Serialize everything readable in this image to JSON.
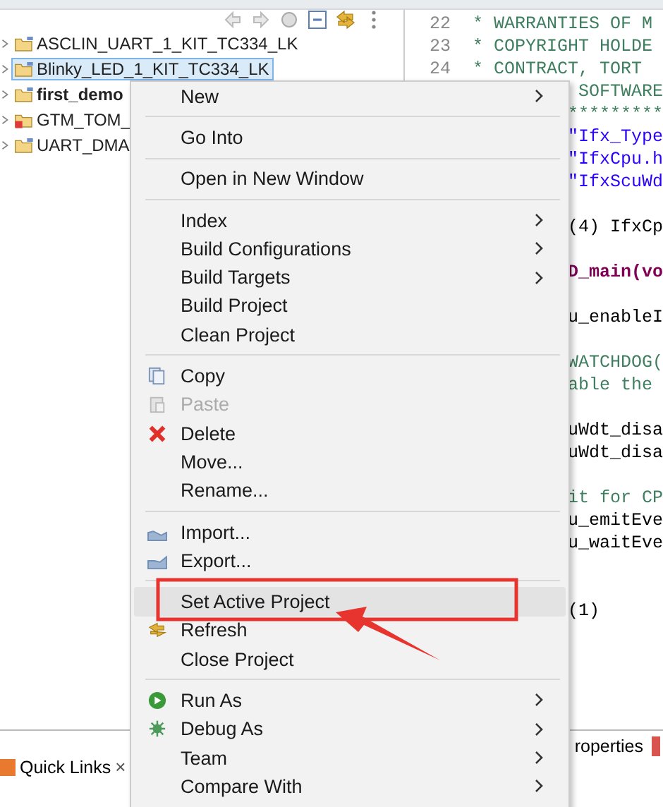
{
  "project_tree": {
    "items": [
      {
        "label": "ASCLIN_UART_1_KIT_TC334_LK",
        "selected": false,
        "bold": false,
        "has_error": false
      },
      {
        "label": "Blinky_LED_1_KIT_TC334_LK",
        "selected": true,
        "bold": false,
        "has_error": false
      },
      {
        "label": "first_demo",
        "selected": false,
        "bold": true,
        "has_error": false
      },
      {
        "label": "GTM_TOM_",
        "selected": false,
        "bold": false,
        "has_error": true
      },
      {
        "label": "UART_DMA",
        "selected": false,
        "bold": false,
        "has_error": false
      }
    ]
  },
  "editor": {
    "numbered_lines": [
      {
        "number": "22",
        "text": " * WARRANTIES OF M",
        "kind": "comment"
      },
      {
        "number": "23",
        "text": " * COPYRIGHT HOLDE",
        "kind": "comment"
      },
      {
        "number": "24",
        "text": " * CONTRACT, TORT",
        "kind": "comment"
      }
    ],
    "visible_fragments": [
      {
        "text": " SOFTWARE",
        "kind": "comment"
      },
      {
        "text": "*********",
        "kind": "comment"
      },
      {
        "text": "\"Ifx_Type",
        "kind": "string"
      },
      {
        "text": "\"IfxCpu.h",
        "kind": "string"
      },
      {
        "text": "\"IfxScuWd",
        "kind": "string"
      },
      {
        "kind": "blank"
      },
      {
        "text": "(4) IfxCp",
        "kind": "code"
      },
      {
        "kind": "blank"
      },
      {
        "text": "D_main(vo",
        "kind": "bold"
      },
      {
        "kind": "blank"
      },
      {
        "text": "u_enableI",
        "kind": "code"
      },
      {
        "kind": "blank"
      },
      {
        "text": "WATCHDOG(",
        "kind": "comment"
      },
      {
        "text": "able the",
        "kind": "comment"
      },
      {
        "kind": "blank"
      },
      {
        "text": "uWdt_disa",
        "kind": "code"
      },
      {
        "text": "uWdt_disa",
        "kind": "code"
      },
      {
        "kind": "blank"
      },
      {
        "text": "it for CP",
        "kind": "comment"
      },
      {
        "text": "u_emitEve",
        "kind": "code"
      },
      {
        "text": "u_waitEve",
        "kind": "code"
      },
      {
        "kind": "blank"
      },
      {
        "kind": "blank"
      },
      {
        "text": "(1)",
        "kind": "code"
      }
    ]
  },
  "context_menu": {
    "sections": [
      [
        {
          "label": "New",
          "submenu": true,
          "disabled": false,
          "selected": false
        }
      ],
      [
        {
          "label": "Go Into",
          "submenu": false,
          "disabled": false,
          "selected": false
        }
      ],
      [
        {
          "label": "Open in New Window",
          "submenu": false,
          "disabled": false,
          "selected": false
        }
      ],
      [
        {
          "label": "Index",
          "submenu": true,
          "disabled": false,
          "selected": false
        },
        {
          "label": "Build Configurations",
          "submenu": true,
          "disabled": false,
          "selected": false
        },
        {
          "label": "Build Targets",
          "submenu": true,
          "disabled": false,
          "selected": false
        },
        {
          "label": "Build Project",
          "submenu": false,
          "disabled": false,
          "selected": false
        },
        {
          "label": "Clean Project",
          "submenu": false,
          "disabled": false,
          "selected": false
        }
      ],
      [
        {
          "label": "Copy",
          "submenu": false,
          "disabled": false,
          "selected": false
        },
        {
          "label": "Paste",
          "submenu": false,
          "disabled": true,
          "selected": false
        },
        {
          "label": "Delete",
          "submenu": false,
          "disabled": false,
          "selected": false
        },
        {
          "label": "Move...",
          "submenu": false,
          "disabled": false,
          "selected": false
        },
        {
          "label": "Rename...",
          "submenu": false,
          "disabled": false,
          "selected": false
        }
      ],
      [
        {
          "label": "Import...",
          "submenu": false,
          "disabled": false,
          "selected": false
        },
        {
          "label": "Export...",
          "submenu": false,
          "disabled": false,
          "selected": false
        }
      ],
      [
        {
          "label": "Set Active Project",
          "submenu": false,
          "disabled": false,
          "selected": true
        },
        {
          "label": "Refresh",
          "submenu": false,
          "disabled": false,
          "selected": false
        },
        {
          "label": "Close Project",
          "submenu": false,
          "disabled": false,
          "selected": false
        }
      ],
      [
        {
          "label": "Run As",
          "submenu": true,
          "disabled": false,
          "selected": false
        },
        {
          "label": "Debug As",
          "submenu": true,
          "disabled": false,
          "selected": false
        },
        {
          "label": "Team",
          "submenu": true,
          "disabled": false,
          "selected": false
        },
        {
          "label": "Compare With",
          "submenu": true,
          "disabled": false,
          "selected": false
        }
      ]
    ]
  },
  "bottom_tabs": [
    {
      "label": "Quick Links",
      "close": "×"
    },
    {
      "label": "roperties"
    }
  ]
}
